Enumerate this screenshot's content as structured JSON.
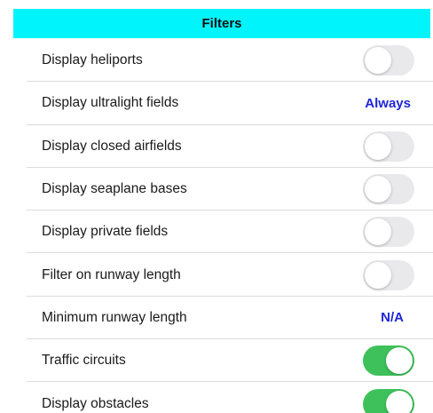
{
  "header": {
    "title": "Filters",
    "color": "#00f4fc"
  },
  "rows": [
    {
      "label": "Display heliports",
      "control": "toggle",
      "on": false
    },
    {
      "label": "Display ultralight fields",
      "control": "value",
      "value": "Always"
    },
    {
      "label": "Display closed airfields",
      "control": "toggle",
      "on": false
    },
    {
      "label": "Display seaplane bases",
      "control": "toggle",
      "on": false
    },
    {
      "label": "Display private fields",
      "control": "toggle",
      "on": false
    },
    {
      "label": "Filter on runway length",
      "control": "toggle",
      "on": false
    },
    {
      "label": "Minimum runway length",
      "control": "value",
      "value": "N/A"
    },
    {
      "label": "Traffic circuits",
      "control": "toggle",
      "on": true
    },
    {
      "label": "Display obstacles",
      "control": "toggle",
      "on": true
    }
  ],
  "colors": {
    "toggle_on": "#3ec15a",
    "toggle_off": "#e9e9ec",
    "link": "#1f26d6"
  }
}
